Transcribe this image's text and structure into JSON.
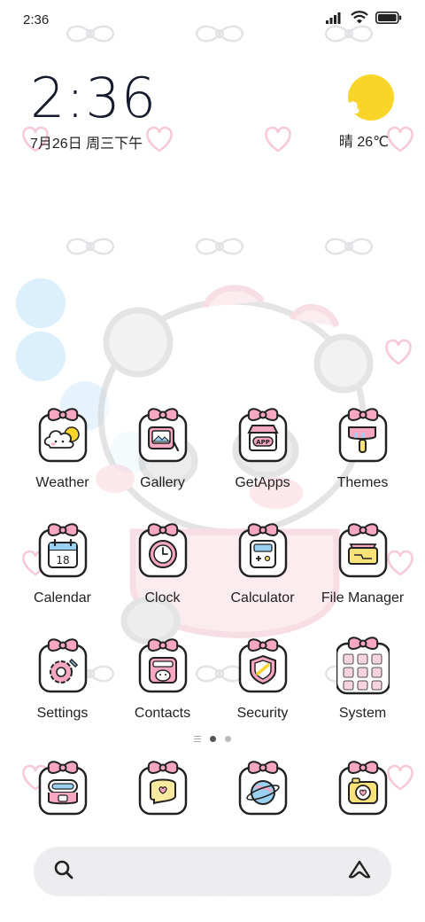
{
  "status_bar": {
    "time": "2:36",
    "icons": [
      "signal-icon",
      "wifi-icon",
      "battery-icon"
    ]
  },
  "clock_widget": {
    "time": "2:36",
    "date": "7月26日 周三下午"
  },
  "weather_widget": {
    "icon": "sunny-cloud-icon",
    "text": "晴 26℃"
  },
  "apps": [
    {
      "label": "Weather",
      "icon": "weather-icon"
    },
    {
      "label": "Gallery",
      "icon": "gallery-icon"
    },
    {
      "label": "GetApps",
      "icon": "getapps-icon"
    },
    {
      "label": "Themes",
      "icon": "themes-icon"
    },
    {
      "label": "Calendar",
      "icon": "calendar-icon",
      "badge_text": "18"
    },
    {
      "label": "Clock",
      "icon": "clock-icon"
    },
    {
      "label": "Calculator",
      "icon": "calculator-icon"
    },
    {
      "label": "File Manager",
      "icon": "file-manager-icon"
    },
    {
      "label": "Settings",
      "icon": "settings-icon"
    },
    {
      "label": "Contacts",
      "icon": "contacts-icon"
    },
    {
      "label": "Security",
      "icon": "security-icon"
    },
    {
      "label": "System",
      "icon": "system-folder-icon"
    }
  ],
  "page_indicator": {
    "pages": 2,
    "current": 1
  },
  "dock": [
    {
      "icon": "messages-icon"
    },
    {
      "icon": "chat-icon"
    },
    {
      "icon": "browser-icon"
    },
    {
      "icon": "camera-icon"
    }
  ],
  "search_bar": {
    "left_icon": "search-icon",
    "right_icon": "assistant-icon"
  },
  "colors": {
    "bow": "#f7a7c2",
    "outline": "#222222",
    "sun": "#f9d52a",
    "wallpaper_heart": "#f6c9d4"
  }
}
